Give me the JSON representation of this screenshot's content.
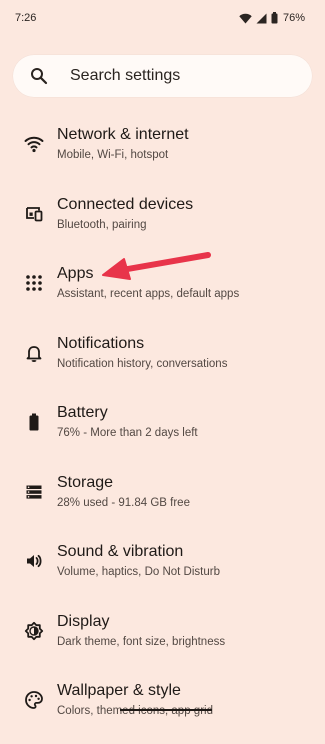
{
  "status_bar": {
    "time": "7:26",
    "battery_percent": "76%",
    "icons": [
      "wifi-icon",
      "signal-icon",
      "battery-icon"
    ]
  },
  "search": {
    "placeholder": "Search settings",
    "icon": "search-icon"
  },
  "settings": {
    "items": [
      {
        "title": "Network & internet",
        "subtitle": "Mobile, Wi-Fi, hotspot",
        "icon": "wifi-icon"
      },
      {
        "title": "Connected devices",
        "subtitle": "Bluetooth, pairing",
        "icon": "connected-devices-icon"
      },
      {
        "title": "Apps",
        "subtitle": "Assistant, recent apps, default apps",
        "icon": "apps-grid-icon"
      },
      {
        "title": "Notifications",
        "subtitle": "Notification history, conversations",
        "icon": "bell-icon"
      },
      {
        "title": "Battery",
        "subtitle": "76% - More than 2 days left",
        "icon": "battery-icon"
      },
      {
        "title": "Storage",
        "subtitle": "28% used - 91.84 GB free",
        "icon": "storage-icon"
      },
      {
        "title": "Sound & vibration",
        "subtitle": "Volume, haptics, Do Not Disturb",
        "icon": "volume-icon"
      },
      {
        "title": "Display",
        "subtitle": "Dark theme, font size, brightness",
        "icon": "brightness-icon"
      },
      {
        "title": "Wallpaper & style",
        "subtitle": "Colors, themed icons, app grid",
        "icon": "palette-icon"
      }
    ]
  },
  "colors": {
    "background": "#fce8df",
    "search_background": "#fffaf7",
    "annotation_arrow": "#e8344a"
  }
}
